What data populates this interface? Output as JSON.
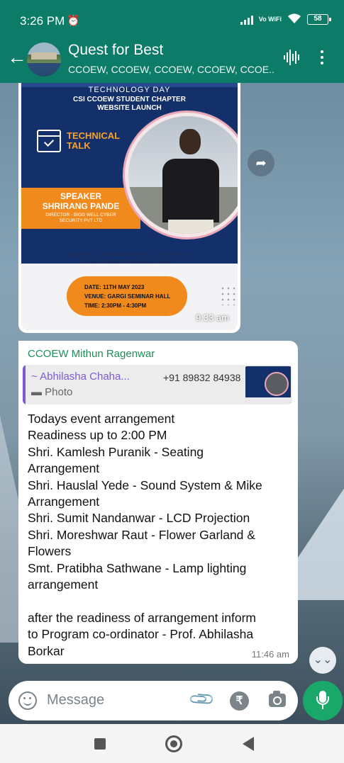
{
  "status_bar": {
    "time": "3:26 PM",
    "alarm_icon": "⏰",
    "network_label": "Vo WiFi",
    "battery": "58"
  },
  "header": {
    "back_icon": "←",
    "group_name": "Quest for Best",
    "members": "CCOEW, CCOEW, CCOEW, CCOEW, CCOE..."
  },
  "image_message": {
    "poster": {
      "heading": "TECHNOLOGY DAY",
      "subheading_line1": "CSI CCOEW STUDENT CHAPTER",
      "subheading_line2": "WEBSITE LAUNCH",
      "talk_line1": "TECHNICAL",
      "talk_line2": "TALK",
      "speaker_label": "SPEAKER",
      "speaker_name": "SHRIRANG PANDE",
      "speaker_role_line1": "DIRECTOR - BIGG WELL CYBER",
      "speaker_role_line2": "SECURITY PVT LTD",
      "tagline_line1": "SECURE YOUR DIGITAL FUTURE: JOIN US FOR",
      "tagline_line2": "THE ULTIMATE TECHNICAL TALK\"",
      "date": "DATE: 11TH MAY 2023",
      "venue": "VENUE: GARGI SEMINAR HALL",
      "time": "TIME: 2:30PM - 4:30PM"
    },
    "timestamp": "9:33 am",
    "share_icon": "➦"
  },
  "text_message": {
    "sender": "CCOEW Mithun Ragenwar",
    "quoted": {
      "name": "~ Abhilasha Chaha...",
      "phone": "+91 89832 84938",
      "type": "▬ Photo"
    },
    "lines": [
      "Todays event arrangement",
      "Readiness up to 2:00 PM",
      "Shri. Kamlesh Puranik - Seating",
      "Arrangement",
      "Shri. Hauslal Yede - Sound System & Mike",
      "Arrangement",
      "Shri. Sumit Nandanwar - LCD Projection",
      "Shri. Moreshwar Raut - Flower Garland &",
      "Flowers",
      "Smt. Pratibha Sathwane - Lamp lighting",
      "arrangement",
      "",
      "after the readiness of arrangement inform",
      "to Program co-ordinator - Prof. Abhilasha",
      "Borkar"
    ],
    "timestamp": "11:46 am"
  },
  "composer": {
    "placeholder": "Message",
    "attach_icon": "📎",
    "rupee_icon": "₹",
    "scroll_down_icon": "⌄⌄"
  },
  "colors": {
    "header_green": "#0c7c68",
    "sender_green": "#1f8d57",
    "quote_purple": "#7e5bd6",
    "mic_green": "#1aa86a"
  }
}
